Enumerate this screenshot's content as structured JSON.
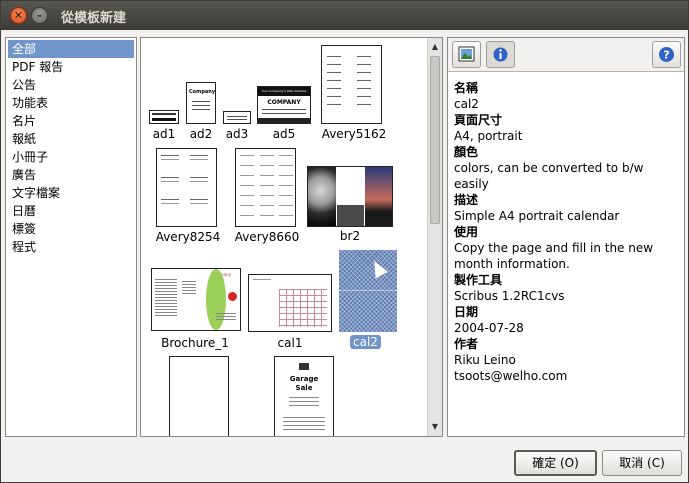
{
  "window": {
    "title": "從模板新建",
    "close_glyph": "✕",
    "minimize_glyph": "–"
  },
  "categories": [
    "全部",
    "PDF 報告",
    "公告",
    "功能表",
    "名片",
    "報紙",
    "小冊子",
    "廣告",
    "文字檔案",
    "日曆",
    "標簽",
    "程式"
  ],
  "selected_category": "全部",
  "templates": [
    "ad1",
    "ad2",
    "ad3",
    "ad5",
    "Avery5162",
    "Avery8254",
    "Avery8660",
    "br2",
    "Brochure_1",
    "cal1",
    "cal2",
    "",
    ""
  ],
  "selected_template": "cal2",
  "thumb_text": {
    "ad2_title": "Company",
    "ad5_header": "Your Company's Web Address",
    "ad5_company": "COMPANY",
    "brochure_title": "Company Name",
    "garage_title": "Garage",
    "garage_sub": "Sale"
  },
  "info": {
    "name_label": "名稱",
    "name_value": "cal2",
    "size_label": "頁面尺寸",
    "size_value": "A4, portrait",
    "color_label": "顏色",
    "color_value": "colors, can be converted to b/w easily",
    "desc_label": "描述",
    "desc_value": "Simple A4 portrait calendar",
    "usage_label": "使用",
    "usage_value": "Copy the page and fill in the new month information.",
    "tool_label": "製作工具",
    "tool_value": "Scribus 1.2RC1cvs",
    "date_label": "日期",
    "date_value": "2004-07-28",
    "author_label": "作者",
    "author_value": "Riku Leino",
    "email_value": "tsoots@welho.com"
  },
  "buttons": {
    "ok": "確定 (O)",
    "cancel": "取消 (C)"
  },
  "icons": {
    "preview_tab": "image-icon",
    "info_tab": "info-icon",
    "help": "help-icon"
  },
  "colors": {
    "selection": "#6f95c9",
    "titlebar": "#3c3b37",
    "close": "#e0541e"
  }
}
